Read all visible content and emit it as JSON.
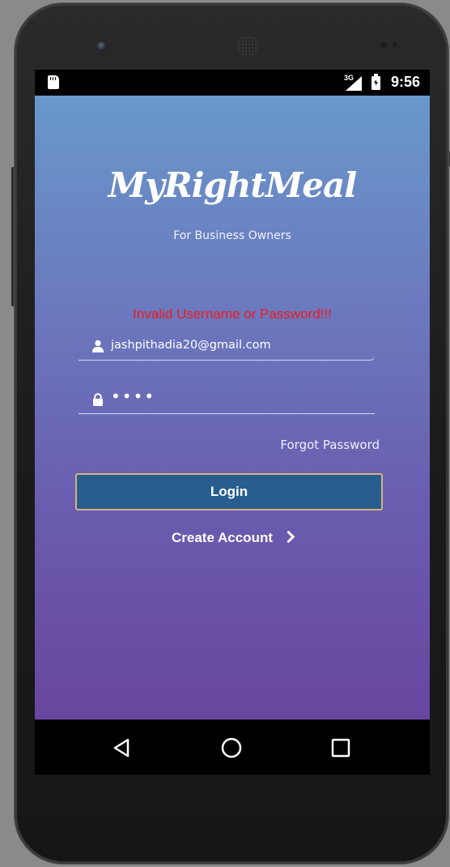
{
  "status_bar": {
    "network_label": "3G",
    "time": "9:56",
    "icons": [
      "sd-card-icon",
      "signal-icon",
      "battery-charging-icon"
    ]
  },
  "app": {
    "logo_text": "MyRightMeal",
    "subtitle": "For Business Owners",
    "error_message": "Invalid Username or Password!!!",
    "username": {
      "value": "jashpithadia20@gmail.com",
      "icon": "user-icon"
    },
    "password": {
      "value": "••••",
      "icon": "lock-icon"
    },
    "forgot_password_label": "Forgot Password",
    "login_label": "Login",
    "create_account_label": "Create Account"
  },
  "colors": {
    "gradient_top": "#6998cb",
    "gradient_bottom": "#68469f",
    "error": "#f2191f",
    "login_button": "#275e8f",
    "login_button_border": "#d6b37a"
  },
  "nav_bar": {
    "icons": [
      "back-icon",
      "home-icon",
      "recents-icon"
    ]
  }
}
